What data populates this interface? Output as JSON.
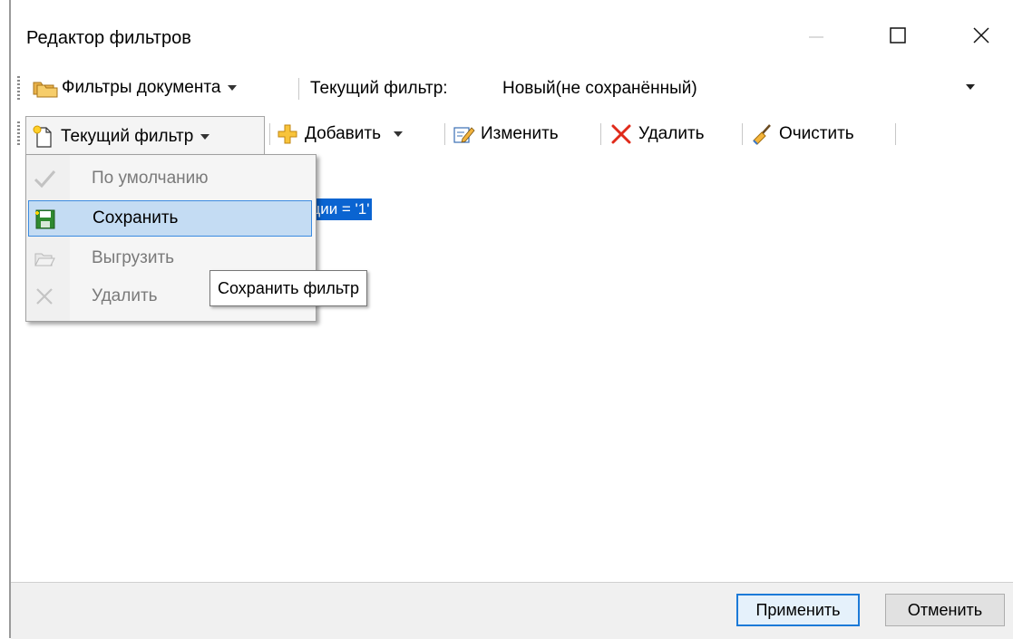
{
  "window": {
    "title": "Редактор фильтров",
    "controls": [
      "minimize-icon",
      "maximize-icon",
      "close-icon"
    ]
  },
  "filters_toolbar": {
    "filters_button": "Фильтры документа",
    "current_filter_label": "Текущий фильтр:",
    "current_filter_value": "Новый(не сохранённый)"
  },
  "actions_toolbar": {
    "current_filter": "Текущий фильтр",
    "add": "Добавить",
    "edit": "Изменить",
    "delete": "Удалить",
    "clear": "Очистить"
  },
  "content": {
    "selected_text": "ации = '1'"
  },
  "menu": {
    "items": [
      {
        "label": "По умолчанию",
        "icon": "checkmark-icon",
        "enabled": false
      },
      {
        "label": "Сохранить",
        "icon": "save-icon",
        "enabled": true,
        "highlighted": true
      },
      {
        "label": "Выгрузить",
        "icon": "open-folder-icon",
        "enabled": false
      },
      {
        "label": "Удалить",
        "icon": "delete-x-icon",
        "enabled": false
      }
    ]
  },
  "tooltip": {
    "text": "Сохранить фильтр"
  },
  "buttons": {
    "apply": "Применить",
    "cancel": "Отменить"
  },
  "colors": {
    "selection": "#0a64d1",
    "menu_highlight": "#c4dcf3",
    "menu_highlight_border": "#3b8be0",
    "default_button_border": "#1c7ad8"
  }
}
